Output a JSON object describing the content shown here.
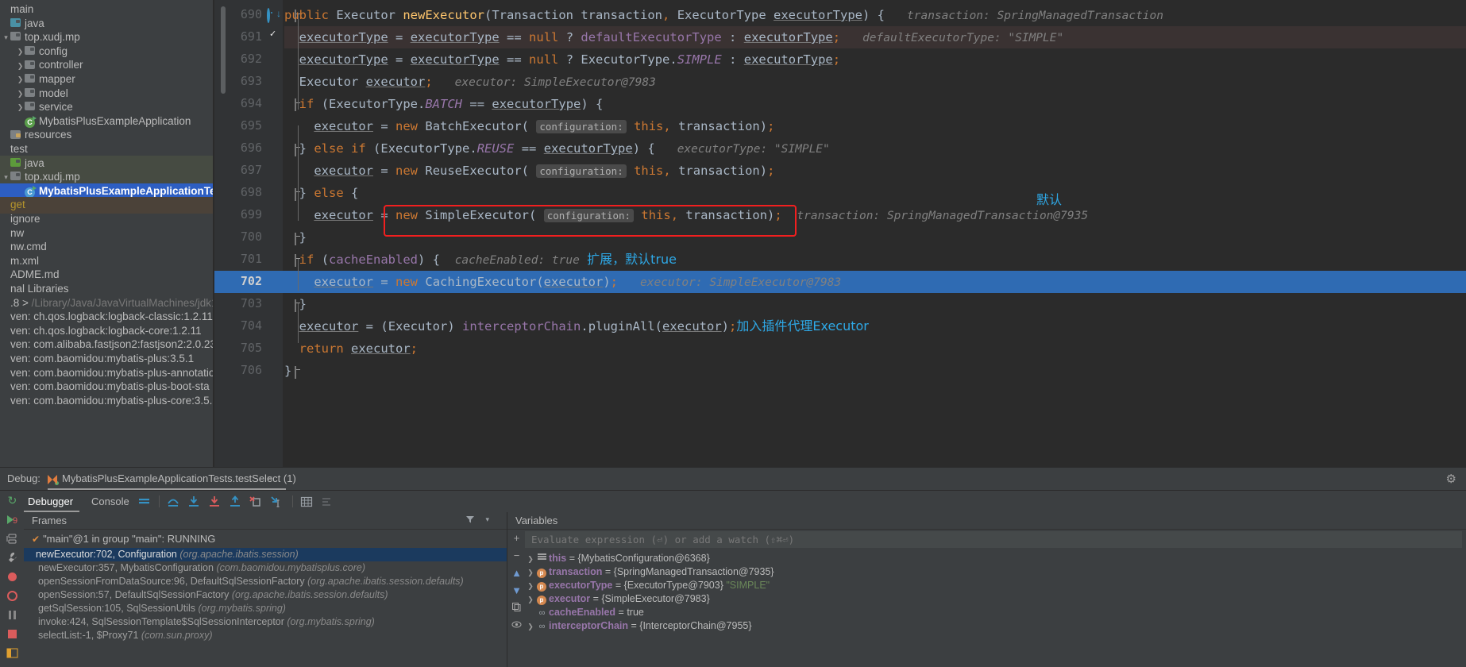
{
  "project_tree": {
    "items": [
      {
        "label": "main",
        "indent": 0,
        "arrow": "",
        "icon": "none",
        "state": "normal"
      },
      {
        "label": "java",
        "indent": 0,
        "arrow": "",
        "icon": "folder-source-blue",
        "state": "normal"
      },
      {
        "label": "top.xudj.mp",
        "indent": 0,
        "arrow": "v",
        "icon": "folder-package",
        "state": "normal"
      },
      {
        "label": "config",
        "indent": 1,
        "arrow": ">",
        "icon": "folder-package",
        "state": "normal"
      },
      {
        "label": "controller",
        "indent": 1,
        "arrow": ">",
        "icon": "folder-package",
        "state": "normal"
      },
      {
        "label": "mapper",
        "indent": 1,
        "arrow": ">",
        "icon": "folder-package",
        "state": "normal"
      },
      {
        "label": "model",
        "indent": 1,
        "arrow": ">",
        "icon": "folder-package",
        "state": "normal"
      },
      {
        "label": "service",
        "indent": 1,
        "arrow": ">",
        "icon": "folder-package",
        "state": "normal"
      },
      {
        "label": "MybatisPlusExampleApplication",
        "indent": 1,
        "arrow": "",
        "icon": "spring-class",
        "state": "normal"
      },
      {
        "label": "resources",
        "indent": 0,
        "arrow": "",
        "icon": "folder-resources",
        "state": "normal"
      },
      {
        "label": "test",
        "indent": 0,
        "arrow": "",
        "icon": "none",
        "state": "normal"
      },
      {
        "label": "java",
        "indent": 0,
        "arrow": "",
        "icon": "folder-test-green",
        "state": "greenbg"
      },
      {
        "label": "top.xudj.mp",
        "indent": 0,
        "arrow": "v",
        "icon": "folder-package",
        "state": "greenbg"
      },
      {
        "label": "MybatisPlusExampleApplicationTes",
        "indent": 1,
        "arrow": "",
        "icon": "test-class",
        "state": "selected"
      },
      {
        "label": "get",
        "indent": 0,
        "arrow": "",
        "icon": "none",
        "state": "brownbg"
      },
      {
        "label": "ignore",
        "indent": 0,
        "arrow": "",
        "icon": "none",
        "state": "normal"
      },
      {
        "label": "nw",
        "indent": 0,
        "arrow": "",
        "icon": "none",
        "state": "normal"
      },
      {
        "label": "nw.cmd",
        "indent": 0,
        "arrow": "",
        "icon": "none",
        "state": "normal"
      },
      {
        "label": "m.xml",
        "indent": 0,
        "arrow": "",
        "icon": "none",
        "state": "normal"
      },
      {
        "label": "ADME.md",
        "indent": 0,
        "arrow": "",
        "icon": "none",
        "state": "normal"
      },
      {
        "label": "nal Libraries",
        "indent": 0,
        "arrow": "",
        "icon": "none",
        "state": "normal"
      },
      {
        "label": ".8 >",
        "indent": 0,
        "arrow": "",
        "icon": "none",
        "state": "normal",
        "suffix": "/Library/Java/JavaVirtualMachines/jdk1"
      },
      {
        "label": "ven: ch.qos.logback:logback-classic:1.2.11",
        "indent": 0,
        "arrow": "",
        "icon": "none",
        "state": "normal"
      },
      {
        "label": "ven: ch.qos.logback:logback-core:1.2.11",
        "indent": 0,
        "arrow": "",
        "icon": "none",
        "state": "normal"
      },
      {
        "label": "ven: com.alibaba.fastjson2:fastjson2:2.0.23",
        "indent": 0,
        "arrow": "",
        "icon": "none",
        "state": "normal"
      },
      {
        "label": "ven: com.baomidou:mybatis-plus:3.5.1",
        "indent": 0,
        "arrow": "",
        "icon": "none",
        "state": "normal"
      },
      {
        "label": "ven: com.baomidou:mybatis-plus-annotatio",
        "indent": 0,
        "arrow": "",
        "icon": "none",
        "state": "normal"
      },
      {
        "label": "ven: com.baomidou:mybatis-plus-boot-sta",
        "indent": 0,
        "arrow": "",
        "icon": "none",
        "state": "normal"
      },
      {
        "label": "ven: com.baomidou:mybatis-plus-core:3.5.",
        "indent": 0,
        "arrow": "",
        "icon": "none",
        "state": "normal"
      }
    ]
  },
  "editor": {
    "lines": [
      {
        "num": "690",
        "gutter": [
          "override-icon",
          "fold-open"
        ],
        "highlight": "none"
      },
      {
        "num": "691",
        "gutter": [
          "breakpoint-verified"
        ],
        "highlight": "breakpoint"
      },
      {
        "num": "692",
        "gutter": [],
        "highlight": "none"
      },
      {
        "num": "693",
        "gutter": [],
        "highlight": "none"
      },
      {
        "num": "694",
        "gutter": [
          "fold-open"
        ],
        "highlight": "none"
      },
      {
        "num": "695",
        "gutter": [],
        "highlight": "none"
      },
      {
        "num": "696",
        "gutter": [
          "fold-close"
        ],
        "highlight": "none"
      },
      {
        "num": "697",
        "gutter": [],
        "highlight": "none"
      },
      {
        "num": "698",
        "gutter": [
          "fold-close"
        ],
        "highlight": "none"
      },
      {
        "num": "699",
        "gutter": [],
        "highlight": "none"
      },
      {
        "num": "700",
        "gutter": [
          "fold-close"
        ],
        "highlight": "none"
      },
      {
        "num": "701",
        "gutter": [
          "fold-open"
        ],
        "highlight": "none"
      },
      {
        "num": "702",
        "gutter": [],
        "highlight": "execution"
      },
      {
        "num": "703",
        "gutter": [
          "fold-close"
        ],
        "highlight": "none"
      },
      {
        "num": "704",
        "gutter": [],
        "highlight": "none"
      },
      {
        "num": "705",
        "gutter": [],
        "highlight": "none"
      },
      {
        "num": "706",
        "gutter": [
          "fold-close"
        ],
        "highlight": "none"
      }
    ],
    "code": {
      "l690": "public Executor newExecutor(Transaction transaction, ExecutorType executorType) {",
      "l690_hint": "transaction: SpringManagedTransaction",
      "l691": "executorType = executorType == null ? defaultExecutorType : executorType;",
      "l691_hint": "defaultExecutorType: \"SIMPLE\"",
      "l692": "executorType = executorType == null ? ExecutorType.SIMPLE : executorType;",
      "l693": "Executor executor;",
      "l693_hint": "executor: SimpleExecutor@7983",
      "l694": "if (ExecutorType.BATCH == executorType) {",
      "l695": "executor = new BatchExecutor( configuration: this, transaction);",
      "l696": "} else if (ExecutorType.REUSE == executorType) {",
      "l696_hint": "executorType: \"SIMPLE\"",
      "l697": "executor = new ReuseExecutor( configuration: this, transaction);",
      "l698": "} else {",
      "l699": "executor = new SimpleExecutor( configuration: this, transaction);",
      "l699_hint": "transaction: SpringManagedTransaction@7935",
      "l700": "}",
      "l701": "if (cacheEnabled) {",
      "l701_hint": "cacheEnabled: true",
      "l702": "executor = new CachingExecutor(executor);",
      "l702_hint": "executor: SimpleExecutor@7983",
      "l703": "}",
      "l704": "executor = (Executor) interceptorChain.pluginAll(executor);",
      "l705": "return executor;",
      "l706": "}",
      "param_hint_configuration": "configuration:"
    },
    "annotations": [
      {
        "text": "默认",
        "color": "#2ea8e6"
      },
      {
        "text": "扩展，默认true",
        "color": "#2ea8e6"
      },
      {
        "text": "加入插件代理Executor",
        "color": "#2ea8e6"
      }
    ],
    "highlight_box_color": "#f21f1f"
  },
  "debug": {
    "label": "Debug:",
    "session_tab": "MybatisPlusExampleApplicationTests.testSelect (1)",
    "close_label": "×",
    "tabs": [
      {
        "label": "Debugger",
        "active": true
      },
      {
        "label": "Console",
        "active": false
      }
    ],
    "frames": {
      "title": "Frames",
      "thread": "\"main\"@1 in group \"main\": RUNNING",
      "rows": [
        {
          "text": "newExecutor:702, Configuration ",
          "pkg": "(org.apache.ibatis.session)",
          "current": true
        },
        {
          "text": "newExecutor:357, MybatisConfiguration ",
          "pkg": "(com.baomidou.mybatisplus.core)",
          "current": false
        },
        {
          "text": "openSessionFromDataSource:96, DefaultSqlSessionFactory ",
          "pkg": "(org.apache.ibatis.session.defaults)",
          "current": false
        },
        {
          "text": "openSession:57, DefaultSqlSessionFactory ",
          "pkg": "(org.apache.ibatis.session.defaults)",
          "current": false
        },
        {
          "text": "getSqlSession:105, SqlSessionUtils ",
          "pkg": "(org.mybatis.spring)",
          "current": false
        },
        {
          "text": "invoke:424, SqlSessionTemplate$SqlSessionInterceptor ",
          "pkg": "(org.mybatis.spring)",
          "current": false
        },
        {
          "text": "selectList:-1, $Proxy71 ",
          "pkg": "(com.sun.proxy)",
          "current": false
        }
      ]
    },
    "variables": {
      "title": "Variables",
      "eval_placeholder": "Evaluate expression (⏎) or add a watch (⇧⌘⏎)",
      "rows": [
        {
          "expand": ">",
          "icon": "object-icon",
          "name": "this",
          "eq": "=",
          "value": "{MybatisConfiguration@6368}"
        },
        {
          "expand": ">",
          "icon": "param-icon",
          "name": "transaction",
          "eq": "=",
          "value": "{SpringManagedTransaction@7935}"
        },
        {
          "expand": ">",
          "icon": "param-icon",
          "name": "executorType",
          "eq": "=",
          "value": "{ExecutorType@7903}",
          "strval": "\"SIMPLE\""
        },
        {
          "expand": ">",
          "icon": "param-icon",
          "name": "executor",
          "eq": "=",
          "value": "{SimpleExecutor@7983}"
        },
        {
          "expand": "",
          "icon": "field-icon",
          "name": "cacheEnabled",
          "eq": "=",
          "value": "true"
        },
        {
          "expand": ">",
          "icon": "field-icon",
          "name": "interceptorChain",
          "eq": "=",
          "value": "{InterceptorChain@7955}"
        }
      ]
    }
  }
}
